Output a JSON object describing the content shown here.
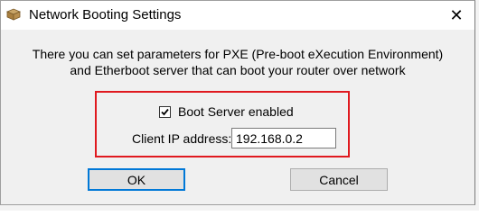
{
  "window": {
    "title": "Network Booting Settings",
    "close_glyph": "✕"
  },
  "description": {
    "line1": "There you can set parameters for PXE (Pre-boot eXecution Environment)",
    "line2": "and Etherboot server that can boot your router over network"
  },
  "boot_server": {
    "checked": true,
    "label": "Boot Server enabled"
  },
  "client_ip": {
    "label": "Client IP address:",
    "value": "192.168.0.2"
  },
  "buttons": {
    "ok": "OK",
    "cancel": "Cancel"
  },
  "colors": {
    "highlight": "#e0191f",
    "dialog_bg": "#f0f0f0",
    "focus": "#0078d7"
  },
  "icons": {
    "app": "package-icon",
    "close": "close-icon",
    "check": "checkmark-icon"
  }
}
